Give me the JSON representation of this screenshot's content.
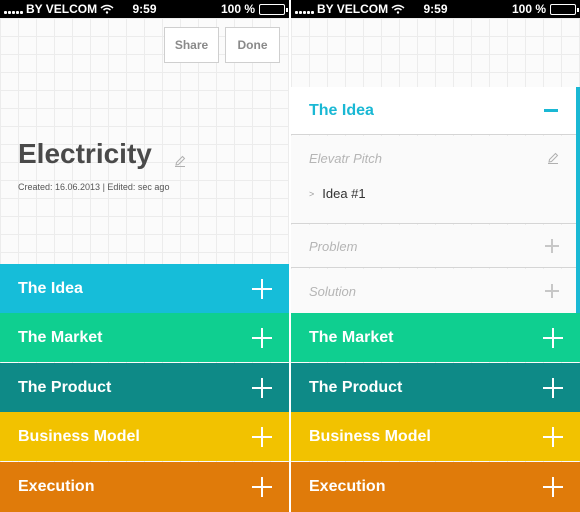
{
  "status": {
    "carrier": "BY VELCOM",
    "time": "9:59",
    "battery": "100 %"
  },
  "left": {
    "share_label": "Share",
    "done_label": "Done",
    "title": "Electricity",
    "meta": "Created: 16.06.2013 | Edited: sec ago",
    "sections": [
      {
        "label": "The Idea",
        "color": "#16bdd9"
      },
      {
        "label": "The Market",
        "color": "#0fcf90"
      },
      {
        "label": "The Product",
        "color": "#0e8a87"
      },
      {
        "label": "Business Model",
        "color": "#f2c200"
      },
      {
        "label": "Execution",
        "color": "#e07b0a"
      }
    ]
  },
  "right": {
    "expanded_label": "The Idea",
    "subsections": [
      {
        "label": "Elevatr Pitch"
      },
      {
        "label": "Problem"
      },
      {
        "label": "Solution"
      }
    ],
    "idea_item": "Idea #1",
    "sections": [
      {
        "label": "The Market",
        "color": "#0fcf90"
      },
      {
        "label": "The Product",
        "color": "#0e8a87"
      },
      {
        "label": "Business Model",
        "color": "#f2c200"
      },
      {
        "label": "Execution",
        "color": "#e07b0a"
      }
    ]
  }
}
